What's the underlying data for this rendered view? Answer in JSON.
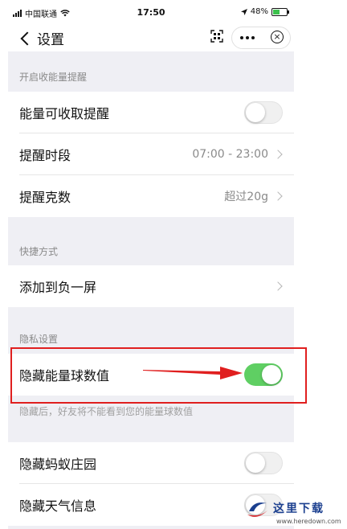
{
  "status_bar": {
    "carrier": "中国联通",
    "time": "17:50",
    "battery": "48%"
  },
  "nav": {
    "title": "设置"
  },
  "sections": {
    "reminder": {
      "header": "开启收能量提醒",
      "energy_reminder_label": "能量可收取提醒",
      "energy_reminder_on": false,
      "period_label": "提醒时段",
      "period_value": "07:00 - 23:00",
      "grams_label": "提醒克数",
      "grams_value": "超过20g"
    },
    "shortcut": {
      "header": "快捷方式",
      "add_label": "添加到负一屏"
    },
    "privacy": {
      "header": "隐私设置",
      "hide_energy_label": "隐藏能量球数值",
      "hide_energy_on": true,
      "hide_energy_hint": "隐藏后，好友将不能看到您的能量球数值",
      "hide_manor_label": "隐藏蚂蚁庄园",
      "hide_manor_on": false,
      "hide_weather_label": "隐藏天气信息",
      "hide_weather_on": false
    }
  },
  "watermark": {
    "title": "这里下载",
    "url": "www.heredown.com"
  },
  "colors": {
    "toggle_on": "#5fcf63",
    "highlight": "#e01f1f",
    "background": "#efeff4"
  }
}
